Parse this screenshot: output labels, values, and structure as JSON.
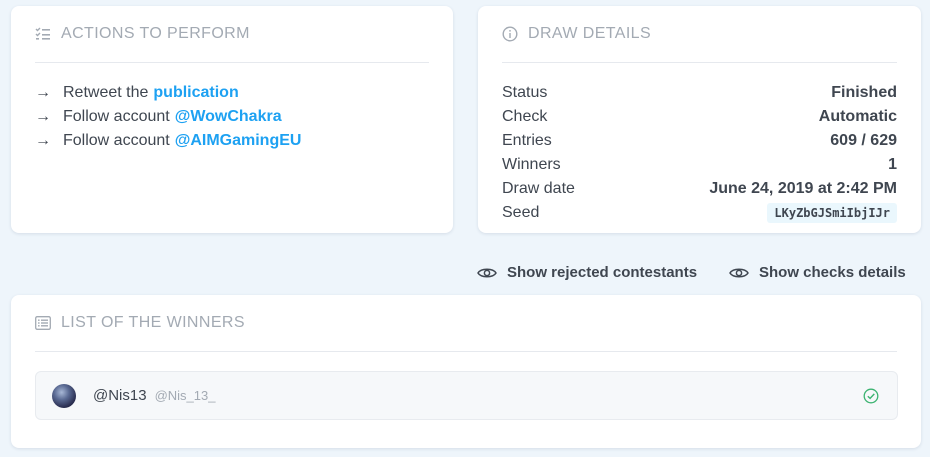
{
  "actions": {
    "title": "ACTIONS TO PERFORM",
    "items": [
      {
        "arrow": "→",
        "text": "Retweet the",
        "link": "publication"
      },
      {
        "arrow": "→",
        "text": "Follow account",
        "link": "@WowChakra"
      },
      {
        "arrow": "→",
        "text": "Follow account",
        "link": "@AIMGamingEU"
      }
    ]
  },
  "details": {
    "title": "DRAW DETAILS",
    "rows": [
      {
        "label": "Status",
        "value": "Finished"
      },
      {
        "label": "Check",
        "value": "Automatic"
      },
      {
        "label": "Entries",
        "value": "609 / 629"
      },
      {
        "label": "Winners",
        "value": "1"
      },
      {
        "label": "Draw date",
        "value": "June 24, 2019 at 2:42 PM"
      },
      {
        "label": "Seed",
        "value": "LKyZbGJSmiIbjIJr"
      }
    ]
  },
  "toggles": {
    "rejected": "Show rejected contestants",
    "checks": "Show checks details"
  },
  "winners": {
    "title": "LIST OF THE WINNERS",
    "items": [
      {
        "name": "@Nis13",
        "handle": "@Nis_13_",
        "status": "verified"
      }
    ]
  },
  "colors": {
    "accent": "#1da1f2",
    "success": "#3cb371",
    "background": "#eef5fb"
  },
  "icons": {
    "actions": "checklist-icon",
    "details": "info-icon",
    "toggle": "eye-icon",
    "winners": "list-icon",
    "winner_status": "check-circle-icon"
  }
}
